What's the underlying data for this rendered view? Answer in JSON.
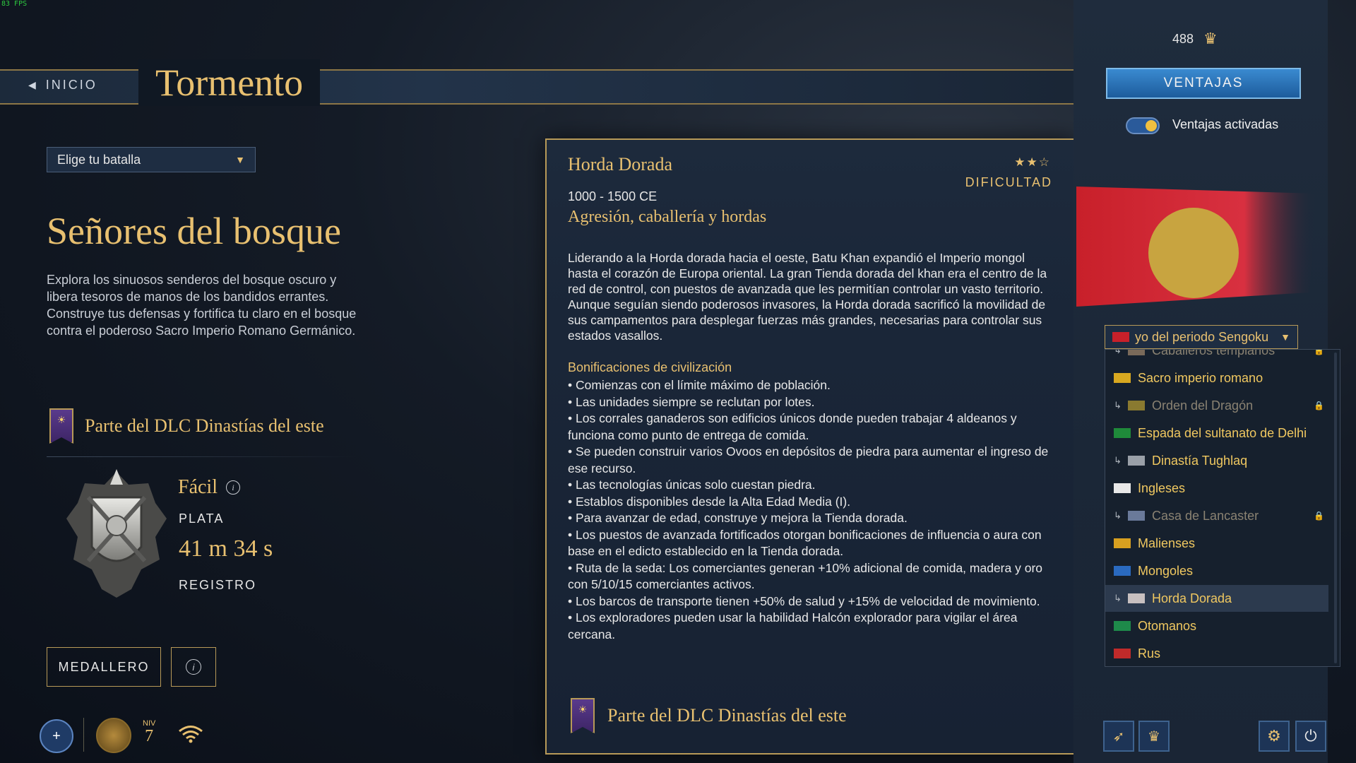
{
  "fps": "83 FPS",
  "header": {
    "back_label": "INICIO",
    "title": "Tormento"
  },
  "battle_select": {
    "value": "Elige tu batalla"
  },
  "scenario": {
    "title": "Señores del bosque",
    "description": "Explora los sinuosos senderos del bosque oscuro y libera tesoros de manos de los bandidos errantes. Construye tus defensas y fortifica tu claro en el bosque contra el poderoso Sacro Imperio Romano Germánico.",
    "dlc_label": "Parte del DLC Dinastías del este",
    "difficulty": "Fácil",
    "tier": "PLATA",
    "time": "41 m 34 s",
    "record_label": "REGISTRO"
  },
  "buttons": {
    "medals": "MEDALLERO"
  },
  "footer": {
    "level_label": "NIV",
    "level_value": "7"
  },
  "civ_panel": {
    "name": "Horda Dorada",
    "stars_filled": 2,
    "stars_total": 3,
    "difficulty_label": "DIFICULTAD",
    "era": "1000 - 1500 CE",
    "tagline": "Agresión, caballería y hordas",
    "lore": "Liderando a la Horda dorada hacia el oeste, Batu Khan expandió el Imperio mongol hasta el corazón de Europa oriental. La gran Tienda dorada del khan era el centro de la red de control, con puestos de avanzada que les permitían controlar un vasto territorio. Aunque seguían siendo poderosos invasores, la Horda dorada sacrificó la movilidad de sus campamentos para desplegar fuerzas más grandes, necesarias para controlar sus estados vasallos.",
    "bonus_title": "Bonificaciones de civilización",
    "bonuses": [
      "• Comienzas con el límite máximo de población.",
      "• Las unidades siempre se reclutan por lotes.",
      "• Los corrales ganaderos son edificios únicos donde pueden trabajar 4 aldeanos y funciona como punto de entrega de comida.",
      "• Se pueden construir varios Ovoos en depósitos de piedra para aumentar el ingreso de ese recurso.",
      "• Las tecnologías únicas solo cuestan piedra.",
      "• Establos disponibles desde la Alta Edad Media (I).",
      "• Para avanzar de edad, construye y mejora la Tienda dorada.",
      "• Los puestos de avanzada fortificados otorgan bonificaciones de influencia o aura con base en el edicto establecido en la Tienda dorada.",
      "• Ruta de la seda: Los comerciantes generan +10% adicional de comida, madera y oro con 5/10/15 comerciantes activos.",
      "• Los barcos de transporte tienen +50% de salud y +15% de velocidad de movimiento.",
      "• Los exploradores pueden usar la habilidad Halcón explorador para vigilar el área cercana."
    ],
    "dlc_label": "Parte del DLC Dinastías del este"
  },
  "right": {
    "currency": "488",
    "advantages_button": "VENTAJAS",
    "toggle_label": "Ventajas activadas",
    "toggle_on": true,
    "civ_select_value": "yo del periodo Sengoku",
    "civ_list": [
      {
        "name": "Caballeros templarios",
        "sub": true,
        "locked": true,
        "flag": "#7a6a5a"
      },
      {
        "name": "Sacro imperio romano",
        "sub": false,
        "locked": false,
        "flag": "#d8a820"
      },
      {
        "name": "Orden del Dragón",
        "sub": true,
        "locked": true,
        "flag": "#8a7a30"
      },
      {
        "name": "Espada del sultanato de Delhi",
        "sub": false,
        "locked": false,
        "flag": "#1f8a3a"
      },
      {
        "name": "Dinastía Tughlaq",
        "sub": true,
        "locked": false,
        "flag": "#9aa0a8"
      },
      {
        "name": "Ingleses",
        "sub": false,
        "locked": false,
        "flag": "#e8e8e8"
      },
      {
        "name": "Casa de Lancaster",
        "sub": true,
        "locked": true,
        "flag": "#6a7a9a"
      },
      {
        "name": "Malienses",
        "sub": false,
        "locked": false,
        "flag": "#d8a020"
      },
      {
        "name": "Mongoles",
        "sub": false,
        "locked": false,
        "flag": "#2a6ac0"
      },
      {
        "name": "Horda Dorada",
        "sub": true,
        "locked": false,
        "flag": "#c8c0c0",
        "selected": true
      },
      {
        "name": "Otomanos",
        "sub": false,
        "locked": false,
        "flag": "#1e8a4a"
      },
      {
        "name": "Rus",
        "sub": false,
        "locked": false,
        "flag": "#c02a2a"
      }
    ]
  },
  "icons": {
    "back": "chevron-left-icon",
    "caret": "chevron-down-icon",
    "info": "info-icon",
    "crown": "crown-icon",
    "plus": "plus-icon",
    "wifi": "wifi-icon",
    "settings": "gear-icon",
    "power": "power-icon",
    "lock": "lock-icon"
  },
  "colors": {
    "gold": "#e8c070",
    "accent_blue": "#2a70b8",
    "panel_border": "#b89a58"
  }
}
